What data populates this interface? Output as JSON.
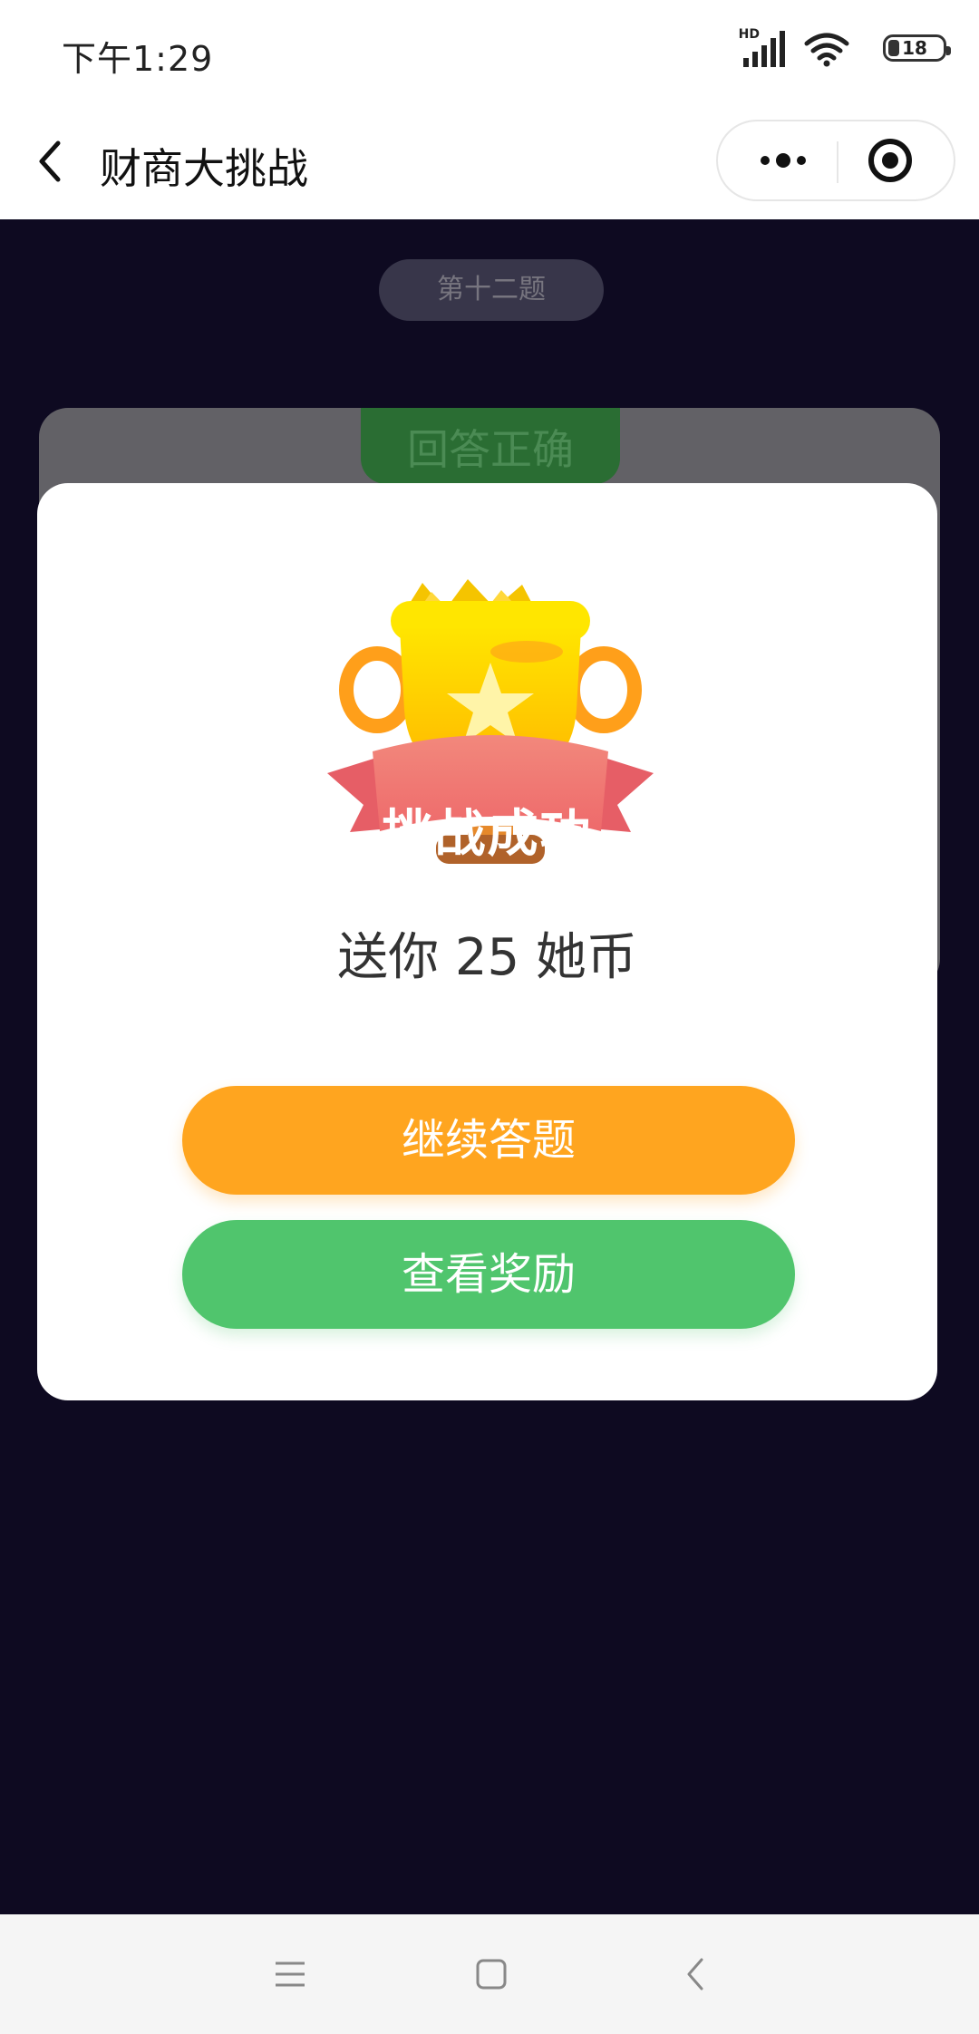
{
  "status_bar": {
    "time": "下午1:29",
    "network_badge": "HD",
    "battery_level": "18",
    "icons": [
      "signal-icon",
      "wifi-icon",
      "battery-icon"
    ]
  },
  "nav_bar": {
    "title": "财商大挑战",
    "icons": [
      "back-icon",
      "more-icon",
      "target-icon"
    ]
  },
  "quiz": {
    "question_label": "第十二题",
    "result_label": "回答正确"
  },
  "modal": {
    "trophy_icon": "trophy-icon",
    "banner_text": "挑战成功",
    "reward_text": "送你 25 她币",
    "continue_label": "继续答题",
    "view_reward_label": "查看奖励"
  },
  "system_nav": {
    "icons": [
      "menu-icon",
      "home-icon",
      "back-icon"
    ]
  },
  "colors": {
    "background": "#0e0a21",
    "continue_button": "#ffa51f",
    "reward_button": "#50c56d",
    "banner": "#ef7670"
  }
}
